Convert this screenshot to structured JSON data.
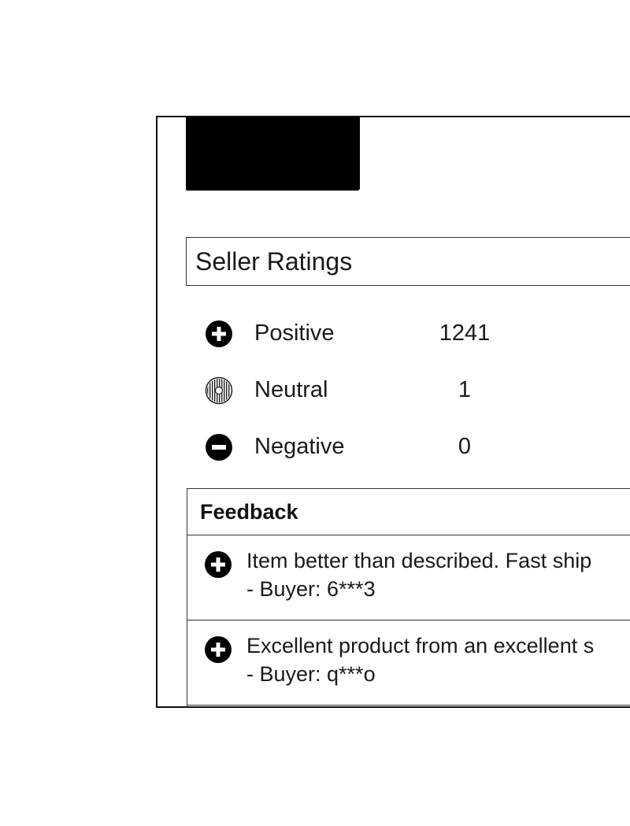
{
  "seller_ratings": {
    "title": "Seller Ratings",
    "rows": [
      {
        "label": "Positive",
        "count": "1241",
        "icon": "plus-circle-icon"
      },
      {
        "label": "Neutral",
        "count": "1",
        "icon": "neutral-circle-icon"
      },
      {
        "label": "Negative",
        "count": "0",
        "icon": "minus-circle-icon"
      }
    ]
  },
  "feedback": {
    "title": "Feedback",
    "items": [
      {
        "comment": "Item better than described. Fast ship",
        "buyer": "- Buyer: 6***3",
        "icon": "plus-circle-icon"
      },
      {
        "comment": "Excellent product from an excellent s",
        "buyer": "- Buyer: q***o",
        "icon": "plus-circle-icon"
      }
    ]
  },
  "colors": {
    "ink": "#111111",
    "background": "#ffffff"
  }
}
